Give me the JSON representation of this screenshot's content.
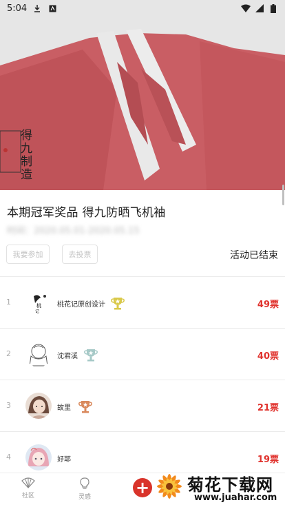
{
  "status_bar": {
    "time": "5:04"
  },
  "hero": {
    "seal_text": "得九制造"
  },
  "event": {
    "title": "本期冠军奖品 得九防晒飞机袖",
    "subtitle": "时间：2020.05.01-2020.05.15",
    "join_button": "我要参加",
    "vote_button": "去投票",
    "status": "活动已结束"
  },
  "ranking": [
    {
      "rank": "1",
      "name": "桃花记原创设计",
      "votes": "49票",
      "trophy": "gold"
    },
    {
      "rank": "2",
      "name": "沈君溪",
      "votes": "40票",
      "trophy": "silver"
    },
    {
      "rank": "3",
      "name": "故里",
      "votes": "21票",
      "trophy": "bronze"
    },
    {
      "rank": "4",
      "name": "好耶",
      "votes": "19票",
      "trophy": "none"
    }
  ],
  "colors": {
    "accent": "#e0332e",
    "gold": "#d9c94a",
    "silver": "#a6c9c7",
    "bronze": "#d9895c"
  },
  "bottom_nav": [
    {
      "label": "社区",
      "icon": "fan-icon"
    },
    {
      "label": "灵感",
      "icon": "lightbulb-icon"
    }
  ],
  "watermark": {
    "title": "菊花下载网",
    "url": "www.juahar.com"
  }
}
